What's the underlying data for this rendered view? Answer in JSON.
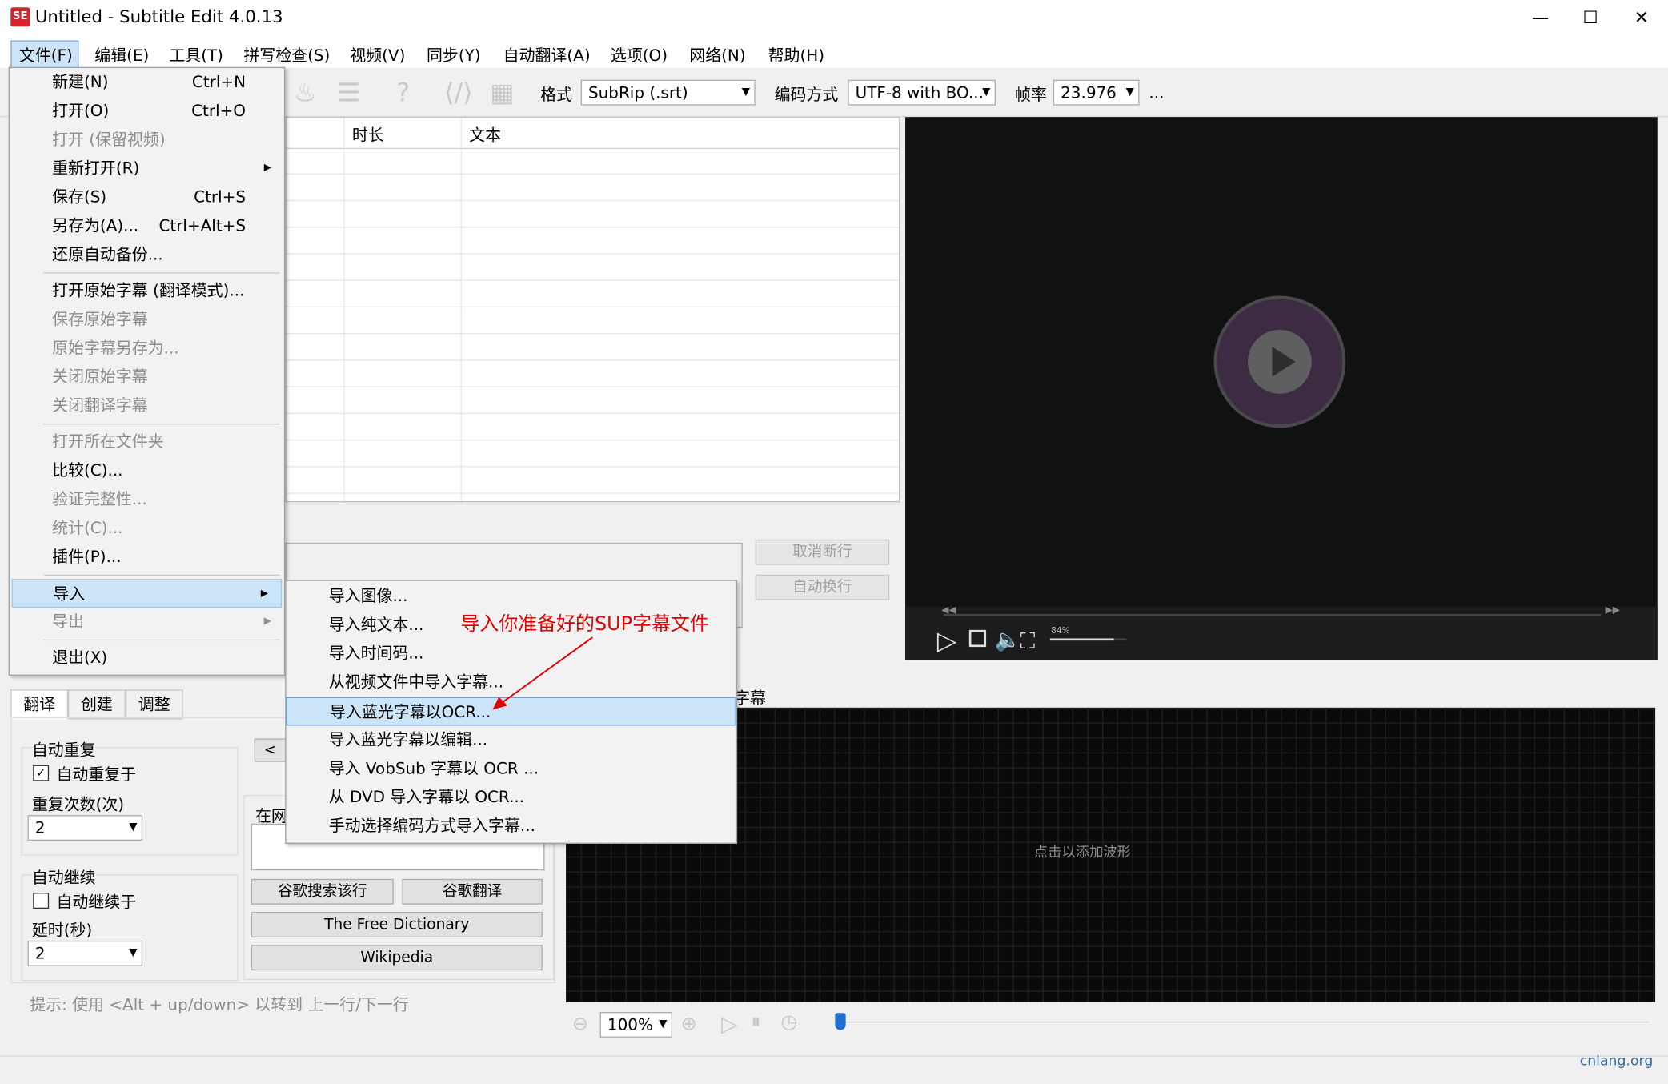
{
  "window": {
    "title": "Untitled - Subtitle Edit 4.0.13",
    "app_icon_text": "SE",
    "minimize": "—",
    "maximize": "☐",
    "close": "✕"
  },
  "menubar": [
    {
      "label": "文件(F)"
    },
    {
      "label": "编辑(E)"
    },
    {
      "label": "工具(T)"
    },
    {
      "label": "拼写检查(S)"
    },
    {
      "label": "视频(V)"
    },
    {
      "label": "同步(Y)"
    },
    {
      "label": "自动翻译(A)"
    },
    {
      "label": "选项(O)"
    },
    {
      "label": "网络(N)"
    },
    {
      "label": "帮助(H)"
    }
  ],
  "toolbar": {
    "format_label": "格式",
    "format_value": "SubRip (.srt)",
    "encoding_label": "编码方式",
    "encoding_value": "UTF-8 with BO...",
    "framerate_label": "帧率",
    "framerate_value": "23.976",
    "more": "..."
  },
  "grid": {
    "columns": [
      "时长",
      "文本"
    ]
  },
  "file_menu": {
    "items": [
      {
        "label": "新建(N)",
        "shortcut": "Ctrl+N",
        "disabled": false
      },
      {
        "label": "打开(O)",
        "shortcut": "Ctrl+O",
        "disabled": false
      },
      {
        "label": "打开 (保留视频)",
        "shortcut": "",
        "disabled": true
      },
      {
        "label": "重新打开(R)",
        "shortcut": "",
        "disabled": false,
        "submenu": true
      },
      {
        "label": "保存(S)",
        "shortcut": "Ctrl+S",
        "disabled": false
      },
      {
        "label": "另存为(A)...",
        "shortcut": "Ctrl+Alt+S",
        "disabled": false
      },
      {
        "label": "还原自动备份...",
        "shortcut": "",
        "disabled": false
      },
      {
        "label": "打开原始字幕 (翻译模式)...",
        "shortcut": "",
        "disabled": false
      },
      {
        "label": "保存原始字幕",
        "shortcut": "",
        "disabled": true
      },
      {
        "label": "原始字幕另存为...",
        "shortcut": "",
        "disabled": true
      },
      {
        "label": "关闭原始字幕",
        "shortcut": "",
        "disabled": true
      },
      {
        "label": "关闭翻译字幕",
        "shortcut": "",
        "disabled": true
      },
      {
        "label": "打开所在文件夹",
        "shortcut": "",
        "disabled": true
      },
      {
        "label": "比较(C)...",
        "shortcut": "",
        "disabled": false
      },
      {
        "label": "验证完整性...",
        "shortcut": "",
        "disabled": true
      },
      {
        "label": "统计(C)...",
        "shortcut": "",
        "disabled": true
      },
      {
        "label": "插件(P)...",
        "shortcut": "",
        "disabled": false
      },
      {
        "label": "导入",
        "shortcut": "",
        "disabled": false,
        "submenu": true,
        "highlighted": true
      },
      {
        "label": "导出",
        "shortcut": "",
        "disabled": true,
        "submenu": true
      },
      {
        "label": "退出(X)",
        "shortcut": "",
        "disabled": false
      }
    ]
  },
  "import_submenu": {
    "items": [
      {
        "label": "导入图像..."
      },
      {
        "label": "导入纯文本..."
      },
      {
        "label": "导入时间码..."
      },
      {
        "label": "从视频文件中导入字幕..."
      },
      {
        "label": "导入蓝光字幕以OCR...",
        "highlighted": true
      },
      {
        "label": "导入蓝光字幕以编辑..."
      },
      {
        "label": "导入 VobSub 字幕以 OCR ..."
      },
      {
        "label": "从 DVD 导入字幕以 OCR..."
      },
      {
        "label": "手动选择编码方式导入字幕..."
      }
    ]
  },
  "annotation": "导入你准备好的SUP字幕文件",
  "edit_buttons": {
    "unbreak": "取消断行",
    "auto_break": "自动换行"
  },
  "video": {
    "volume_label": "84%"
  },
  "tabs": [
    "翻译",
    "创建",
    "调整"
  ],
  "translate_panel": {
    "auto_repeat_group": "自动重复",
    "auto_repeat_on": "自动重复于",
    "auto_repeat_checked": true,
    "repeat_count_label": "重复次数(次)",
    "repeat_count_value": "2",
    "auto_continue_group": "自动继续",
    "auto_continue_on": "自动继续于",
    "auto_continue_checked": false,
    "delay_label": "延时(秒)",
    "delay_value": "2",
    "prev_button": "<",
    "online_label": "在网",
    "google_search": "谷歌搜索该行",
    "google_translate": "谷歌翻译",
    "free_dictionary": "The Free Dictionary",
    "wikipedia": "Wikipedia",
    "hint": "提示: 使用 <Alt + up/down> 以转到 上一行/下一行"
  },
  "waveform": {
    "label_fragment": "字幕",
    "placeholder": "点击以添加波形",
    "zoom_value": "100%"
  },
  "watermark": "cnlang.org"
}
